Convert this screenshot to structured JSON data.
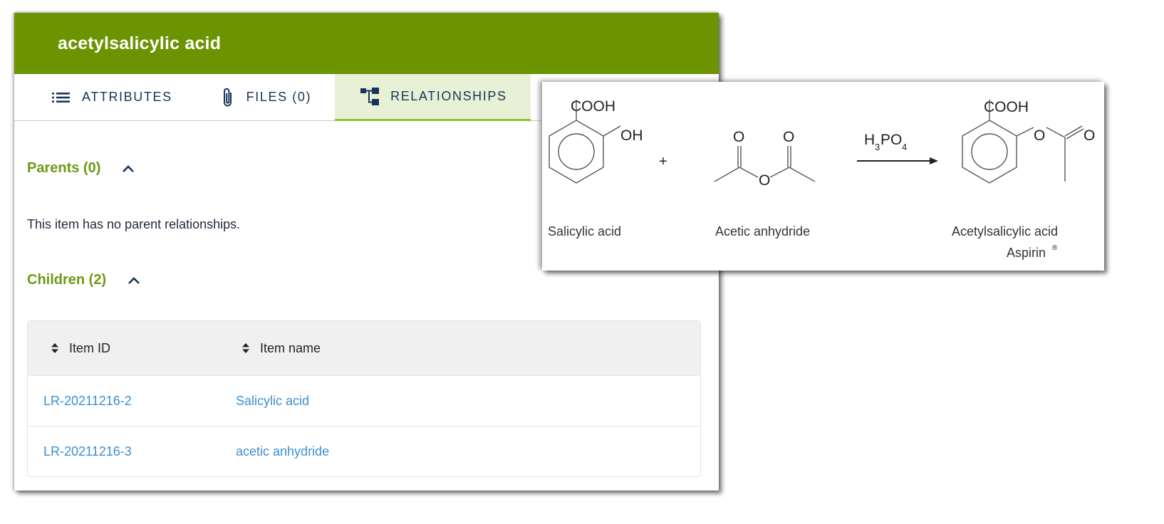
{
  "header": {
    "title": "acetylsalicylic acid",
    "color": "#6b9400"
  },
  "tabs": [
    {
      "label": "ATTRIBUTES",
      "icon": "list-icon",
      "active": false
    },
    {
      "label": "FILES (0)",
      "icon": "paperclip-icon",
      "active": false
    },
    {
      "label": "RELATIONSHIPS",
      "icon": "hierarchy-icon",
      "active": true
    }
  ],
  "parents": {
    "title": "Parents (0)",
    "empty_message": "This item has no parent relationships."
  },
  "children": {
    "title": "Children (2)",
    "columns": [
      "Item ID",
      "Item name"
    ],
    "rows": [
      {
        "id": "LR-20211216-2",
        "name": "Salicylic acid"
      },
      {
        "id": "LR-20211216-3",
        "name": "acetic anhydride"
      }
    ]
  },
  "reaction": {
    "reactant1": {
      "label": "Salicylic acid",
      "groups": [
        "COOH",
        "OH"
      ]
    },
    "plus": "+",
    "reactant2": {
      "label": "Acetic anhydride",
      "atoms": [
        "O",
        "O",
        "O"
      ]
    },
    "catalyst": {
      "base": "H",
      "sub1": "3",
      "mid": "PO",
      "sub2": "4"
    },
    "product": {
      "label": "Acetylsalicylic acid",
      "trade_name": "Aspirin",
      "trademark": "®",
      "groups": [
        "COOH",
        "O",
        "O"
      ]
    }
  },
  "colors": {
    "accent_green": "#6b9a12",
    "link_blue": "#3b8fd0",
    "tab_text": "#16345a",
    "active_tab_bg": "#e8f1d6"
  }
}
